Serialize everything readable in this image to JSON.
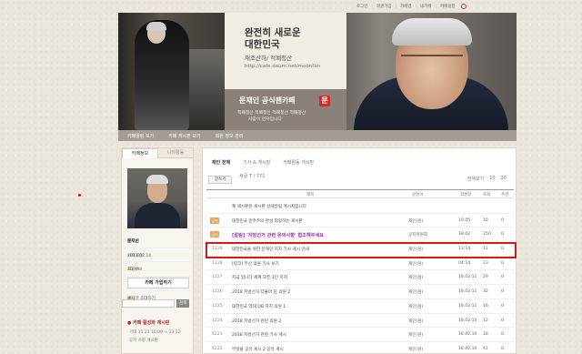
{
  "util_bar": {
    "items": [
      "로그인",
      "회원가입",
      "카페앱",
      "내카페",
      "카페설정"
    ]
  },
  "banner": {
    "headline1": "완전히 새로운",
    "headline2": "대한민국",
    "slogan": "재조산하/ 적폐청산",
    "url": "http://cafe.daum.net/moonfan",
    "cafe_title": "문재인 공식팬카페",
    "cafe_sub1": "적폐청산 적폐청산 적폐청산 적폐청산",
    "cafe_sub2": "사람이 먼저입니다",
    "logo_char": "문"
  },
  "nav": {
    "items": [
      "카페알림 보기",
      "카페 게시판 보기",
      "회원 정보 관리"
    ]
  },
  "sidebar": {
    "tab_active": "카페정보",
    "tab_inactive": "나의활동",
    "owner_label": "매니저",
    "owner_name": "문재인",
    "since_label": "카페개설",
    "since_value": "2011.02.10",
    "rank_label": "랭킹",
    "rank_value": "",
    "members_label": "회원수",
    "members_value": "30,948",
    "visit_label": "방문수",
    "visit_value": "8,749",
    "posts_label": "게시글",
    "posts_value": "891",
    "visit_extra": "초대하기",
    "join_button": "카페 가입하기",
    "search_button": "검색",
    "section_title": "카페 활성화 게시판",
    "sub1": "기대 11.21 10:00 ~ 13:12",
    "sub2": "공지 사항 게시판"
  },
  "board": {
    "tab_active": "재인 전체",
    "tab2": "기사 & 게시판",
    "tab3": "카페활동 게시판",
    "meta_prefix": "새글",
    "meta_count": "7",
    "meta_total": "771",
    "write_button": "글쓰기",
    "right_controls": [
      "전체보기",
      "10",
      "20"
    ],
    "columns": {
      "title": "제목",
      "author": "글쓴이",
      "date": "작성일",
      "views": "조회",
      "likes": "추천"
    },
    "rows": [
      {
        "no": "",
        "badge": "",
        "title": "제 게시판은 게시판 상세알림 메시지입니다",
        "style": "normal",
        "author": "",
        "date": "",
        "views": "",
        "likes": ""
      },
      {
        "no": "",
        "badge": "공지",
        "title": "대한민국 민주주의 완성 희망하는 게시판",
        "style": "normal",
        "author": "재인(원)",
        "date": "19.05",
        "views": "10",
        "likes": "0"
      },
      {
        "no": "",
        "badge": "공지",
        "title": "[알림] '지방선거 관련 유의사항' 협조해주세요",
        "style": "purple",
        "author": "공지위원회",
        "date": "18.02",
        "views": "250",
        "likes": "0"
      },
      {
        "no": "1229",
        "badge": "",
        "title": "대한민국을 위한 문재인 지지 기사 게시 안내",
        "style": "normal",
        "author": "재인(원)",
        "date": "13:54",
        "views": "11",
        "likes": "0"
      },
      {
        "no": "1228",
        "badge": "",
        "title": "[링크] 부산 의원 기사 보기",
        "style": "normal",
        "author": "재인(원)",
        "date": "04:54",
        "views": "23",
        "likes": "0"
      },
      {
        "no": "1227",
        "badge": "",
        "title": "지금 입니다 세계 모든 1인 지지",
        "style": "normal",
        "author": "재인(원)",
        "date": "18.02.11",
        "views": "29",
        "likes": "0"
      },
      {
        "no": "1226",
        "badge": "",
        "title": "2018 지방선거 더불어 당 의원 2",
        "style": "normal",
        "author": "재인(원)",
        "date": "18.02.11",
        "views": "32",
        "likes": "0"
      },
      {
        "no": "1225",
        "badge": "",
        "title": "대한민국 역대 DB 지지 의원 1",
        "style": "normal",
        "author": "재인(원)",
        "date": "18.02.11",
        "views": "16",
        "likes": "0"
      },
      {
        "no": "1224",
        "badge": "",
        "title": "2018 지방선거 관련 의원 2",
        "style": "normal",
        "author": "재인(원)",
        "date": "18.02.10",
        "views": "12",
        "likes": "0"
      },
      {
        "no": "1223",
        "badge": "",
        "title": "2018 지방선거 관련 기사 게시",
        "style": "normal",
        "author": "재인(원)",
        "date": "18.02.10",
        "views": "18",
        "likes": "0"
      },
      {
        "no": "1222",
        "badge": "",
        "title": "무엇을 공유 게시 2 공유 게시",
        "style": "normal",
        "author": "재인(원)",
        "date": "18.02.10",
        "views": "41",
        "likes": "0"
      }
    ]
  }
}
